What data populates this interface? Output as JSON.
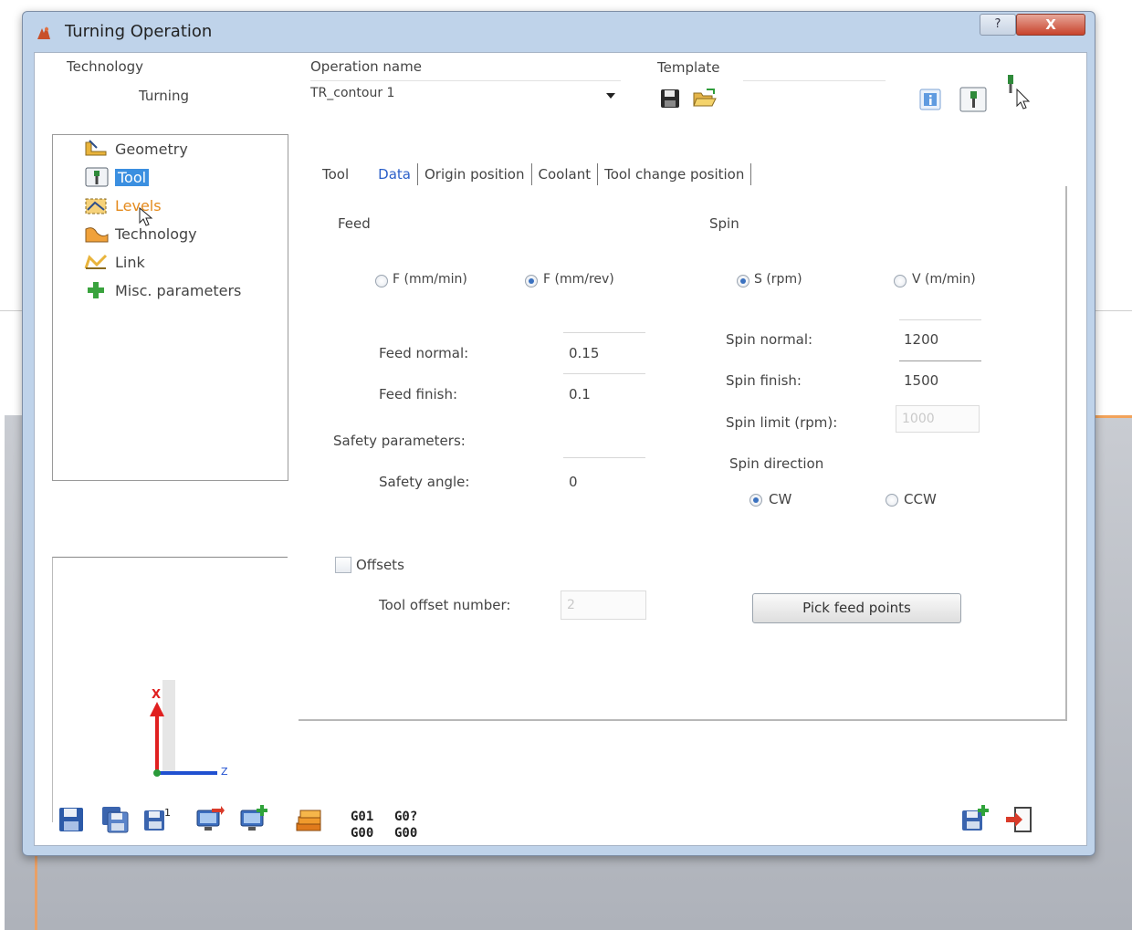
{
  "window": {
    "title": "Turning Operation",
    "help_button": "?",
    "close_button": "X"
  },
  "header": {
    "technology_label": "Technology",
    "technology_value": "Turning",
    "operation_name_label": "Operation name",
    "operation_name_value": "TR_contour 1",
    "template_label": "Template",
    "icons": [
      "save-template-icon",
      "open-template-icon",
      "info-icon",
      "tool-icon",
      "pick-icon"
    ]
  },
  "tree": {
    "items": [
      {
        "label": "Geometry",
        "icon": "geometry-icon"
      },
      {
        "label": "Tool",
        "icon": "tool-icon",
        "selected": true
      },
      {
        "label": "Levels",
        "icon": "levels-icon"
      },
      {
        "label": "Technology",
        "icon": "technology-icon"
      },
      {
        "label": "Link",
        "icon": "link-icon"
      },
      {
        "label": "Misc. parameters",
        "icon": "plus-icon"
      }
    ]
  },
  "tabs": [
    {
      "label": "Tool"
    },
    {
      "label": "Data",
      "active": true
    },
    {
      "label": "Origin position"
    },
    {
      "label": "Coolant"
    },
    {
      "label": "Tool change position"
    }
  ],
  "feed": {
    "group_label": "Feed",
    "option_mm_min": "F (mm/min)",
    "option_mm_rev": "F (mm/rev)",
    "selected": "mm_rev",
    "normal_label": "Feed normal:",
    "normal_value": "0.15",
    "finish_label": "Feed finish:",
    "finish_value": "0.1"
  },
  "safety": {
    "group_label": "Safety parameters:",
    "angle_label": "Safety angle:",
    "angle_value": "0"
  },
  "spin": {
    "group_label": "Spin",
    "option_rpm": "S (rpm)",
    "option_m_min": "V (m/min)",
    "selected": "rpm",
    "normal_label": "Spin normal:",
    "normal_value": "1200",
    "finish_label": "Spin finish:",
    "finish_value": "1500",
    "limit_label": "Spin limit (rpm):",
    "limit_value": "1000",
    "direction_label": "Spin direction",
    "option_cw": "CW",
    "option_ccw": "CCW",
    "direction_selected": "cw"
  },
  "offsets": {
    "checkbox_label": "Offsets",
    "checked": false,
    "tool_offset_label": "Tool offset number:",
    "tool_offset_value": "2"
  },
  "pick_feed_points": "Pick feed points",
  "preview_axes": {
    "x_label": "X",
    "z_label": "Z"
  },
  "bottom_toolbar": {
    "gcode_a_top": "G01",
    "gcode_a_bottom": "G00",
    "gcode_b_top": "G0?",
    "gcode_b_bottom": "G00"
  }
}
